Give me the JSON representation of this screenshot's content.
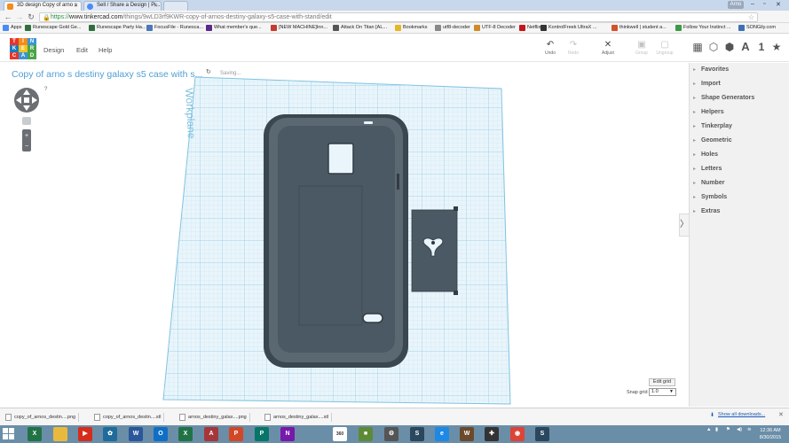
{
  "browser": {
    "tabs": [
      {
        "title": "3D design Copy of arno s",
        "active": true
      },
      {
        "title": "Sell / Share a Design | Pi...",
        "active": false
      }
    ],
    "user": "Arno",
    "url": {
      "https": "https://",
      "host": "www.tinkercad.com",
      "path": "/things/9wLD3rf9KWR-copy-of-arnos-destiny-galaxy-s5-case-with-stand/edit"
    },
    "bookmarks": [
      {
        "label": "Apps",
        "color": "#4c8bf5"
      },
      {
        "label": "Runescape Gold Ge...",
        "color": "#2f6f3e"
      },
      {
        "label": "Runescape Party Ha...",
        "color": "#2f6f3e"
      },
      {
        "label": "FocusFile - Runesca...",
        "color": "#4a78b8"
      },
      {
        "label": "What member's que...",
        "color": "#5b2a8c"
      },
      {
        "label": "[NEW MACHINE]Inn...",
        "color": "#c43b2f"
      },
      {
        "label": "Attack On Titan [AL...",
        "color": "#555555"
      },
      {
        "label": "Bookmarks",
        "color": "#e6b629"
      },
      {
        "label": "utf8-decoder",
        "color": "#888888"
      },
      {
        "label": "UTF-8 Decoder",
        "color": "#d08a28"
      },
      {
        "label": "Netflix",
        "color": "#c4161c"
      },
      {
        "label": "KontrolFreek UltraX ...",
        "color": "#333333"
      },
      {
        "label": "thinkwell | student a...",
        "color": "#d2522a"
      },
      {
        "label": "Follow Your Instinct ...",
        "color": "#3a9a46"
      },
      {
        "label": "SONGily.com",
        "color": "#3f6fb5"
      }
    ]
  },
  "app": {
    "logo": [
      {
        "letter": "T",
        "color": "#e5372d"
      },
      {
        "letter": "I",
        "color": "#f28c1d"
      },
      {
        "letter": "N",
        "color": "#3a96d4"
      },
      {
        "letter": "K",
        "color": "#1b7cc1"
      },
      {
        "letter": "E",
        "color": "#f4c320"
      },
      {
        "letter": "R",
        "color": "#4aa548"
      },
      {
        "letter": "C",
        "color": "#e5372d"
      },
      {
        "letter": "A",
        "color": "#3a96d4"
      },
      {
        "letter": "D",
        "color": "#4aa548"
      }
    ],
    "menu": [
      "Design",
      "Edit",
      "Help"
    ],
    "toolbar": {
      "undo": "Undo",
      "redo": "Redo",
      "adjust": "Adjust",
      "group": "Group",
      "ungroup": "Ungroup"
    },
    "view_text": "A",
    "view_number": "1",
    "design_title": "Copy of arno  s destiny galaxy s5 case with s...",
    "saving": "Saving...",
    "workplane_label": "Workplane",
    "edit_grid": "Edit grid",
    "snap_grid_label": "Snap grid",
    "snap_grid_value": "1.0",
    "accent": "#4f9fd4",
    "shape_color": "#4b5964"
  },
  "panel": {
    "categories": [
      "Favorites",
      "Import",
      "Shape Generators",
      "Helpers",
      "Tinkerplay",
      "Geometric",
      "Holes",
      "Letters",
      "Number",
      "Symbols",
      "Extras"
    ]
  },
  "downloads": {
    "items": [
      "copy_of_arnos_destin....png",
      "copy_of_arnos_destin....stl",
      "arnos_destiny_galax....png",
      "arnos_destiny_galax....stl"
    ],
    "show_all": "Show all downloads...",
    "show_all_icon": "download-arrow-icon"
  },
  "taskbar": {
    "apps": [
      {
        "name": "excel-icon",
        "label": "X",
        "color": "#217346"
      },
      {
        "name": "file-explorer-icon",
        "label": "",
        "color": "#e9b93e"
      },
      {
        "name": "youtube-icon",
        "label": "▶",
        "color": "#d62c1a"
      },
      {
        "name": "settings-icon",
        "label": "✿",
        "color": "#1f6b9b"
      },
      {
        "name": "word-icon",
        "label": "W",
        "color": "#2b579a"
      },
      {
        "name": "outlook-icon",
        "label": "O",
        "color": "#0f6fc6"
      },
      {
        "name": "excel-icon",
        "label": "X",
        "color": "#217346"
      },
      {
        "name": "access-icon",
        "label": "A",
        "color": "#a4373a"
      },
      {
        "name": "powerpoint-icon",
        "label": "P",
        "color": "#d24726"
      },
      {
        "name": "publisher-icon",
        "label": "P",
        "color": "#077568"
      },
      {
        "name": "onenote-icon",
        "label": "N",
        "color": "#7719aa"
      },
      {
        "name": "360-icon",
        "label": "360",
        "color": "#ffffff"
      },
      {
        "name": "minecraft-icon",
        "label": "■",
        "color": "#5c8a36"
      },
      {
        "name": "tools-icon",
        "label": "⚙",
        "color": "#555555"
      },
      {
        "name": "steam-icon",
        "label": "S",
        "color": "#2a475e"
      },
      {
        "name": "edge-icon",
        "label": "e",
        "color": "#1e88e5"
      },
      {
        "name": "tank-icon",
        "label": "W",
        "color": "#6b4a2b"
      },
      {
        "name": "game-controller-icon",
        "label": "✚",
        "color": "#333333"
      },
      {
        "name": "chrome-icon",
        "label": "◉",
        "color": "#db4437"
      },
      {
        "name": "steam-icon",
        "label": "S",
        "color": "#2a475e"
      }
    ],
    "time": "12:36 AM",
    "date": "8/30/2015"
  }
}
